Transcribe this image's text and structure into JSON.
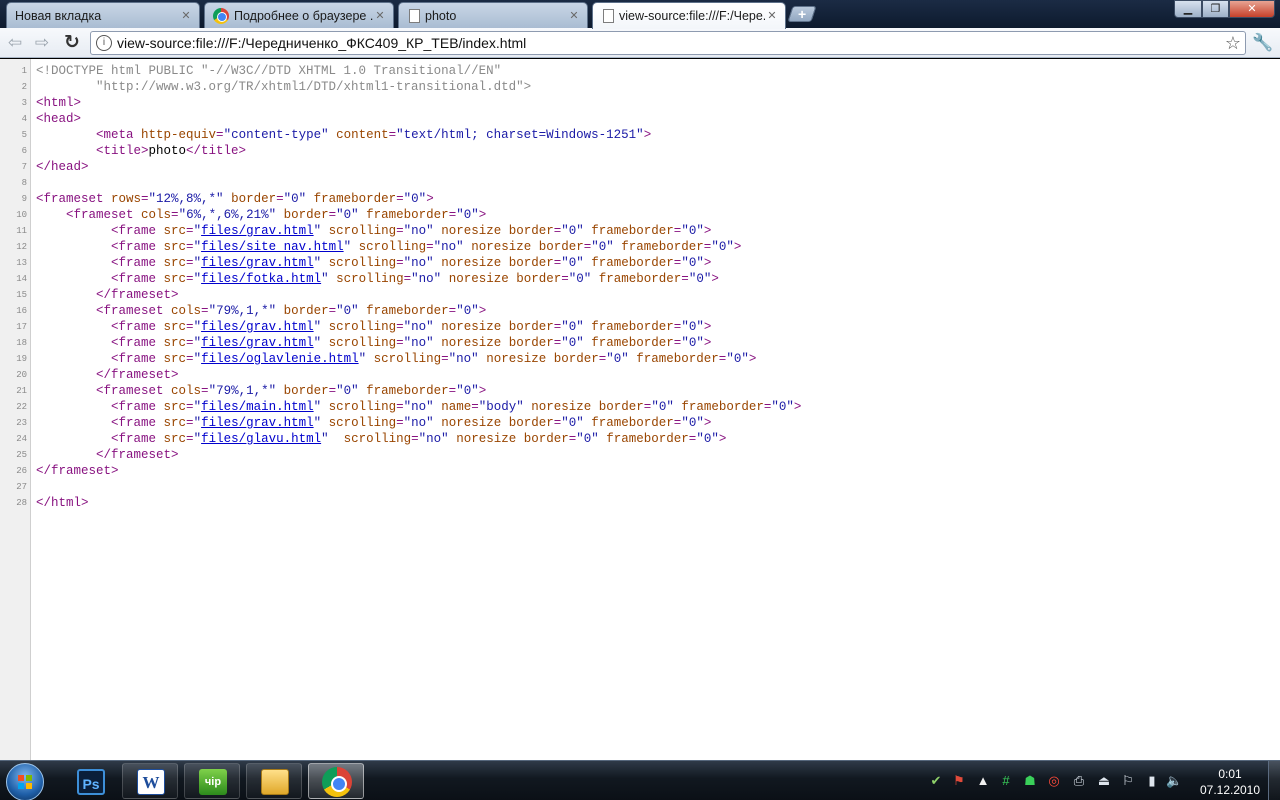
{
  "tabs": [
    {
      "title": "Новая вкладка",
      "favicon": "none",
      "active": false
    },
    {
      "title": "Подробнее о браузере ...",
      "favicon": "chrome-logo-icon",
      "active": false
    },
    {
      "title": "photo",
      "favicon": "page-icon",
      "active": false
    },
    {
      "title": "view-source:file:///F:/Чере...",
      "favicon": "page-icon",
      "active": true
    }
  ],
  "toolbar": {
    "url": "view-source:file:///F:/Чередниченко_ФКС409_КР_ТЕВ/index.html"
  },
  "source_lines": [
    {
      "n": "1",
      "html": "<span class=\"doctype\">&lt;!DOCTYPE html PUBLIC \"-//W3C//DTD XHTML 1.0 Transitional//EN\"</span>"
    },
    {
      "n": "2",
      "html": "<span class=\"doctype\">        \"http://www.w3.org/TR/xhtml1/DTD/xhtml1-transitional.dtd\"&gt;</span>"
    },
    {
      "n": "3",
      "html": "<span class=\"tag\">&lt;html&gt;</span>"
    },
    {
      "n": "4",
      "html": "<span class=\"tag\">&lt;head&gt;</span>"
    },
    {
      "n": "5",
      "html": "        <span class=\"tag\">&lt;meta </span><span class=\"attr\">http-equiv</span><span class=\"tag\">=</span><span class=\"val\">\"content-type\"</span> <span class=\"attr\">content</span><span class=\"tag\">=</span><span class=\"val\">\"text/html; charset=Windows-1251\"</span><span class=\"tag\">&gt;</span>"
    },
    {
      "n": "6",
      "html": "        <span class=\"tag\">&lt;title&gt;</span><span class=\"txt\">photo</span><span class=\"tag\">&lt;/title&gt;</span>"
    },
    {
      "n": "7",
      "html": "<span class=\"tag\">&lt;/head&gt;</span>"
    },
    {
      "n": "8",
      "html": ""
    },
    {
      "n": "9",
      "html": "<span class=\"tag\">&lt;frameset </span><span class=\"attr\">rows</span><span class=\"tag\">=</span><span class=\"val\">\"12%,8%,*\"</span> <span class=\"attr\">border</span><span class=\"tag\">=</span><span class=\"val\">\"0\"</span> <span class=\"attr\">frameborder</span><span class=\"tag\">=</span><span class=\"val\">\"0\"</span><span class=\"tag\">&gt;</span>"
    },
    {
      "n": "10",
      "html": "    <span class=\"tag\">&lt;frameset </span><span class=\"attr\">cols</span><span class=\"tag\">=</span><span class=\"val\">\"6%,*,6%,21%\"</span> <span class=\"attr\">border</span><span class=\"tag\">=</span><span class=\"val\">\"0\"</span> <span class=\"attr\">frameborder</span><span class=\"tag\">=</span><span class=\"val\">\"0\"</span><span class=\"tag\">&gt;</span>"
    },
    {
      "n": "11",
      "html": "          <span class=\"tag\">&lt;frame </span><span class=\"attr\">src</span><span class=\"tag\">=</span><span class=\"val\">\"<a class=\"lnk\">files/grav.html</a>\"</span> <span class=\"attr\">scrolling</span><span class=\"tag\">=</span><span class=\"val\">\"no\"</span> <span class=\"attr\">noresize border</span><span class=\"tag\">=</span><span class=\"val\">\"0\"</span> <span class=\"attr\">frameborder</span><span class=\"tag\">=</span><span class=\"val\">\"0\"</span><span class=\"tag\">&gt;</span>"
    },
    {
      "n": "12",
      "html": "          <span class=\"tag\">&lt;frame </span><span class=\"attr\">src</span><span class=\"tag\">=</span><span class=\"val\">\"<a class=\"lnk\">files/site_nav.html</a>\"</span> <span class=\"attr\">scrolling</span><span class=\"tag\">=</span><span class=\"val\">\"no\"</span> <span class=\"attr\">noresize border</span><span class=\"tag\">=</span><span class=\"val\">\"0\"</span> <span class=\"attr\">frameborder</span><span class=\"tag\">=</span><span class=\"val\">\"0\"</span><span class=\"tag\">&gt;</span>"
    },
    {
      "n": "13",
      "html": "          <span class=\"tag\">&lt;frame </span><span class=\"attr\">src</span><span class=\"tag\">=</span><span class=\"val\">\"<a class=\"lnk\">files/grav.html</a>\"</span> <span class=\"attr\">scrolling</span><span class=\"tag\">=</span><span class=\"val\">\"no\"</span> <span class=\"attr\">noresize border</span><span class=\"tag\">=</span><span class=\"val\">\"0\"</span> <span class=\"attr\">frameborder</span><span class=\"tag\">=</span><span class=\"val\">\"0\"</span><span class=\"tag\">&gt;</span>"
    },
    {
      "n": "14",
      "html": "          <span class=\"tag\">&lt;frame </span><span class=\"attr\">src</span><span class=\"tag\">=</span><span class=\"val\">\"<a class=\"lnk\">files/fotka.html</a>\"</span> <span class=\"attr\">scrolling</span><span class=\"tag\">=</span><span class=\"val\">\"no\"</span> <span class=\"attr\">noresize border</span><span class=\"tag\">=</span><span class=\"val\">\"0\"</span> <span class=\"attr\">frameborder</span><span class=\"tag\">=</span><span class=\"val\">\"0\"</span><span class=\"tag\">&gt;</span>"
    },
    {
      "n": "15",
      "html": "        <span class=\"tag\">&lt;/frameset&gt;</span>"
    },
    {
      "n": "16",
      "html": "        <span class=\"tag\">&lt;frameset </span><span class=\"attr\">cols</span><span class=\"tag\">=</span><span class=\"val\">\"79%,1,*\"</span> <span class=\"attr\">border</span><span class=\"tag\">=</span><span class=\"val\">\"0\"</span> <span class=\"attr\">frameborder</span><span class=\"tag\">=</span><span class=\"val\">\"0\"</span><span class=\"tag\">&gt;</span>"
    },
    {
      "n": "17",
      "html": "          <span class=\"tag\">&lt;frame </span><span class=\"attr\">src</span><span class=\"tag\">=</span><span class=\"val\">\"<a class=\"lnk\">files/grav.html</a>\"</span> <span class=\"attr\">scrolling</span><span class=\"tag\">=</span><span class=\"val\">\"no\"</span> <span class=\"attr\">noresize border</span><span class=\"tag\">=</span><span class=\"val\">\"0\"</span> <span class=\"attr\">frameborder</span><span class=\"tag\">=</span><span class=\"val\">\"0\"</span><span class=\"tag\">&gt;</span>"
    },
    {
      "n": "18",
      "html": "          <span class=\"tag\">&lt;frame </span><span class=\"attr\">src</span><span class=\"tag\">=</span><span class=\"val\">\"<a class=\"lnk\">files/grav.html</a>\"</span> <span class=\"attr\">scrolling</span><span class=\"tag\">=</span><span class=\"val\">\"no\"</span> <span class=\"attr\">noresize border</span><span class=\"tag\">=</span><span class=\"val\">\"0\"</span> <span class=\"attr\">frameborder</span><span class=\"tag\">=</span><span class=\"val\">\"0\"</span><span class=\"tag\">&gt;</span>"
    },
    {
      "n": "19",
      "html": "          <span class=\"tag\">&lt;frame </span><span class=\"attr\">src</span><span class=\"tag\">=</span><span class=\"val\">\"<a class=\"lnk\">files/oglavlenie.html</a>\"</span> <span class=\"attr\">scrolling</span><span class=\"tag\">=</span><span class=\"val\">\"no\"</span> <span class=\"attr\">noresize border</span><span class=\"tag\">=</span><span class=\"val\">\"0\"</span> <span class=\"attr\">frameborder</span><span class=\"tag\">=</span><span class=\"val\">\"0\"</span><span class=\"tag\">&gt;</span>"
    },
    {
      "n": "20",
      "html": "        <span class=\"tag\">&lt;/frameset&gt;</span>"
    },
    {
      "n": "21",
      "html": "        <span class=\"tag\">&lt;frameset </span><span class=\"attr\">cols</span><span class=\"tag\">=</span><span class=\"val\">\"79%,1,*\"</span> <span class=\"attr\">border</span><span class=\"tag\">=</span><span class=\"val\">\"0\"</span> <span class=\"attr\">frameborder</span><span class=\"tag\">=</span><span class=\"val\">\"0\"</span><span class=\"tag\">&gt;</span>"
    },
    {
      "n": "22",
      "html": "          <span class=\"tag\">&lt;frame </span><span class=\"attr\">src</span><span class=\"tag\">=</span><span class=\"val\">\"<a class=\"lnk\">files/main.html</a>\"</span> <span class=\"attr\">scrolling</span><span class=\"tag\">=</span><span class=\"val\">\"no\"</span> <span class=\"attr\">name</span><span class=\"tag\">=</span><span class=\"val\">\"body\"</span> <span class=\"attr\">noresize border</span><span class=\"tag\">=</span><span class=\"val\">\"0\"</span> <span class=\"attr\">frameborder</span><span class=\"tag\">=</span><span class=\"val\">\"0\"</span><span class=\"tag\">&gt;</span>"
    },
    {
      "n": "23",
      "html": "          <span class=\"tag\">&lt;frame </span><span class=\"attr\">src</span><span class=\"tag\">=</span><span class=\"val\">\"<a class=\"lnk\">files/grav.html</a>\"</span> <span class=\"attr\">scrolling</span><span class=\"tag\">=</span><span class=\"val\">\"no\"</span> <span class=\"attr\">noresize border</span><span class=\"tag\">=</span><span class=\"val\">\"0\"</span> <span class=\"attr\">frameborder</span><span class=\"tag\">=</span><span class=\"val\">\"0\"</span><span class=\"tag\">&gt;</span>"
    },
    {
      "n": "24",
      "html": "          <span class=\"tag\">&lt;frame </span><span class=\"attr\">src</span><span class=\"tag\">=</span><span class=\"val\">\"<a class=\"lnk\">files/glavu.html</a>\"</span>  <span class=\"attr\">scrolling</span><span class=\"tag\">=</span><span class=\"val\">\"no\"</span> <span class=\"attr\">noresize border</span><span class=\"tag\">=</span><span class=\"val\">\"0\"</span> <span class=\"attr\">frameborder</span><span class=\"tag\">=</span><span class=\"val\">\"0\"</span><span class=\"tag\">&gt;</span>"
    },
    {
      "n": "25",
      "html": "        <span class=\"tag\">&lt;/frameset&gt;</span>"
    },
    {
      "n": "26",
      "html": "<span class=\"tag\">&lt;/frameset&gt;</span>"
    },
    {
      "n": "27",
      "html": ""
    },
    {
      "n": "28",
      "html": "<span class=\"tag\">&lt;/html&gt;</span>"
    }
  ],
  "taskbar": {
    "apps": [
      {
        "name": "photoshop",
        "glyph": "Ps"
      },
      {
        "name": "word",
        "glyph": "W"
      },
      {
        "name": "device-manager",
        "glyph": "чір"
      },
      {
        "name": "explorer",
        "glyph": ""
      },
      {
        "name": "chrome",
        "glyph": ""
      }
    ],
    "tray_icons": [
      "network-check-icon",
      "flag-red-icon",
      "warning-icon",
      "green-hash-icon",
      "green-robot-icon",
      "opera-icon",
      "printer-icon",
      "safely-remove-icon",
      "action-center-flag-icon",
      "power-icon",
      "volume-icon"
    ],
    "clock_time": "0:01",
    "clock_date": "07.12.2010"
  },
  "colors": {
    "tag": "#881280",
    "attribute": "#994500",
    "value": "#1a1aa6",
    "link": "#0000cc",
    "doctype": "#8a8a8a"
  }
}
